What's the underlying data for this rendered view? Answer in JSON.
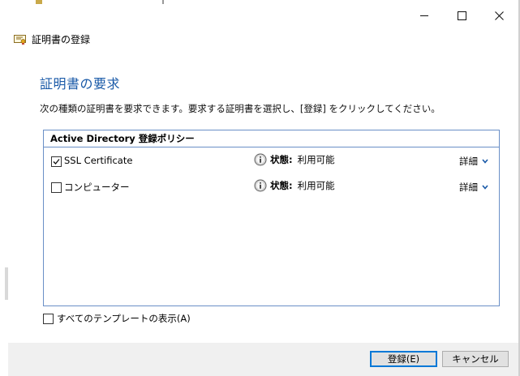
{
  "window": {
    "title": "証明書の登録",
    "controls": {
      "minimize_icon": "minimize-icon",
      "maximize_icon": "maximize-icon",
      "close_icon": "close-icon"
    }
  },
  "page": {
    "section_title": "証明書の要求",
    "instruction": "次の種類の証明書を要求できます。要求する証明書を選択し、[登録] をクリックしてください。"
  },
  "policy": {
    "header": "Active Directory 登録ポリシー",
    "items": [
      {
        "name": "SSL Certificate",
        "checked": true,
        "status_label": "状態:",
        "status_value": "利用可能",
        "detail_label": "詳細"
      },
      {
        "name": "コンピューター",
        "checked": false,
        "status_label": "状態:",
        "status_value": "利用可能",
        "detail_label": "詳細"
      }
    ]
  },
  "show_all_templates": {
    "label": "すべてのテンプレートの表示(A)",
    "checked": false
  },
  "buttons": {
    "register": "登録(E)",
    "cancel": "キャンセル"
  },
  "colors": {
    "accent": "#1a5aa8",
    "box_border": "#6a8fc7",
    "footer_bg": "#f0f0f0",
    "default_button_border": "#0078d7"
  }
}
